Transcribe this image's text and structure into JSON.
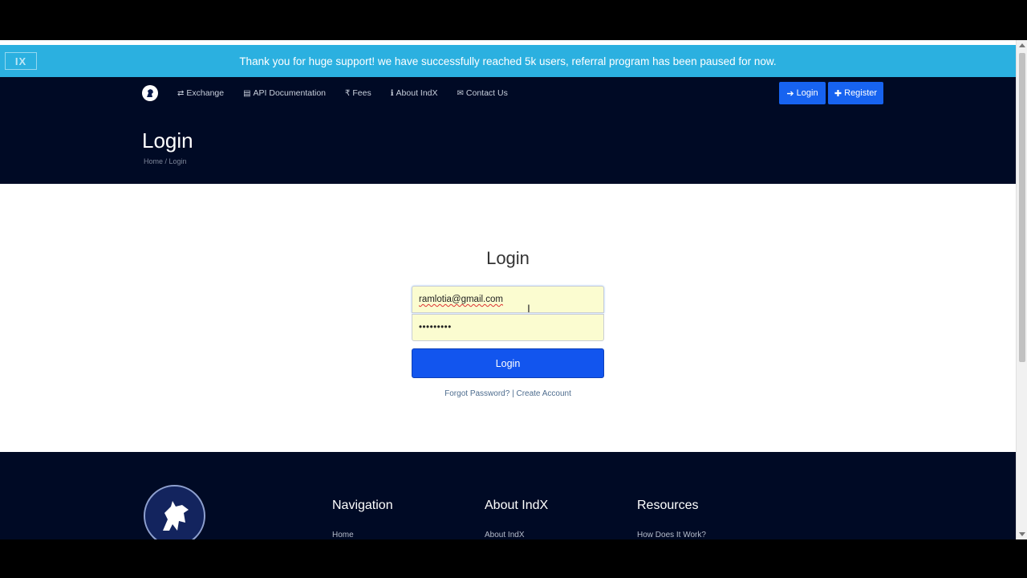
{
  "announcement": {
    "logo_text": "IX",
    "text": "Thank you for huge support! we have successfully reached 5k users, referral program has been paused for now."
  },
  "nav": {
    "items": [
      {
        "label": "Exchange",
        "icon": "exchange-icon",
        "glyph": "⇄"
      },
      {
        "label": "API Documentation",
        "icon": "book-icon",
        "glyph": "▤"
      },
      {
        "label": "Fees",
        "icon": "rupee-icon",
        "glyph": "₹"
      },
      {
        "label": "About IndX",
        "icon": "info-icon",
        "glyph": "ℹ"
      },
      {
        "label": "Contact Us",
        "icon": "envelope-icon",
        "glyph": "✉"
      }
    ],
    "login_label": "Login",
    "register_label": "Register"
  },
  "page": {
    "title": "Login",
    "breadcrumb": "Home / Login"
  },
  "form": {
    "title": "Login",
    "email_value": "ramlotia@gmail.com",
    "password_value": "•••••••••",
    "submit_label": "Login",
    "forgot_label": "Forgot Password?",
    "separator": "|",
    "create_label": "Create Account"
  },
  "footer": {
    "columns": [
      {
        "title": "Navigation",
        "first_link": "Home"
      },
      {
        "title": "About IndX",
        "first_link": "About IndX"
      },
      {
        "title": "Resources",
        "first_link": "How Does It Work?"
      }
    ]
  },
  "colors": {
    "announcement_bg": "#2bb0e0",
    "header_bg": "#000a25",
    "primary_button": "#1255ee"
  }
}
